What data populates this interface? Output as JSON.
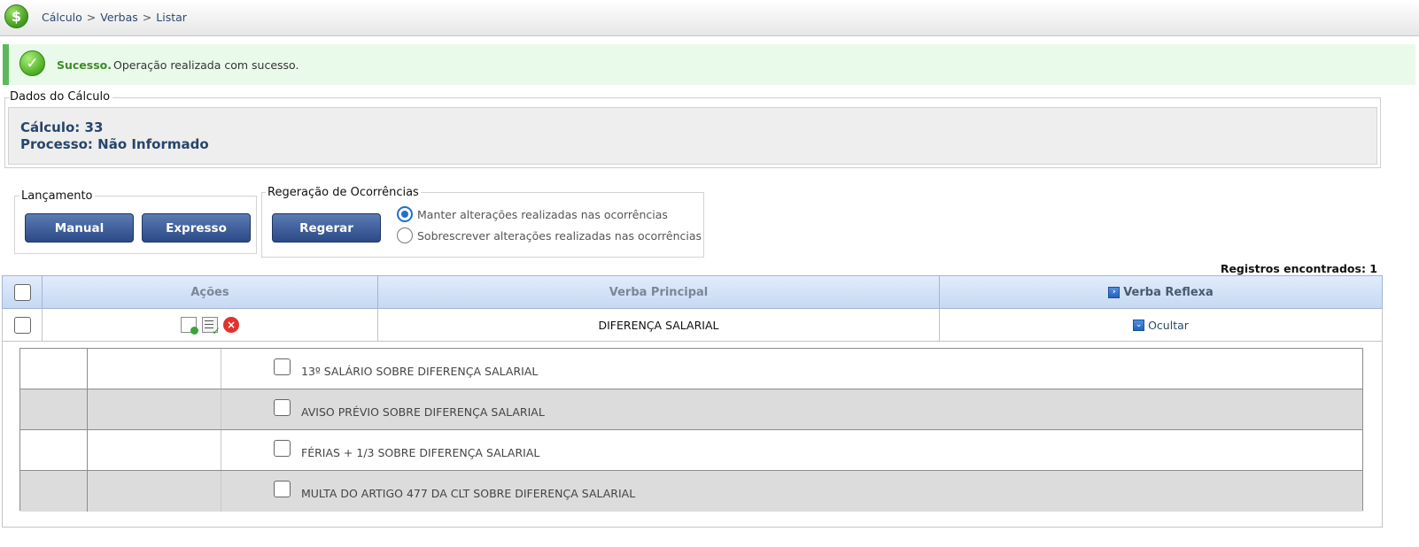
{
  "header": {
    "logo_symbol": "$",
    "breadcrumb": [
      "Cálculo",
      "Verbas",
      "Listar"
    ],
    "separator": ">"
  },
  "message": {
    "title": "Sucesso.",
    "text": "Operação realizada com sucesso.",
    "icon": "check-circle-icon"
  },
  "dados": {
    "legend": "Dados do Cálculo",
    "calculo": "Cálculo: 33",
    "processo": "Processo: Não Informado"
  },
  "lancamento": {
    "legend": "Lançamento",
    "manual_label": "Manual",
    "expresso_label": "Expresso"
  },
  "regeneracao": {
    "legend": "Regeração de Ocorrências",
    "regerar_label": "Regerar",
    "options": [
      {
        "label": "Manter alterações realizadas nas ocorrências",
        "selected": true
      },
      {
        "label": "Sobrescrever alterações realizadas nas ocorrências",
        "selected": false
      }
    ]
  },
  "records": "Registros encontrados: 1",
  "table": {
    "columns": [
      "Ações",
      "Verba Principal",
      "Verba Reflexa"
    ],
    "rows": [
      {
        "verba_principal": "DIFERENÇA SALARIAL",
        "verba_reflexa_action": "Ocultar"
      }
    ]
  },
  "reflexas": [
    "13º SALÁRIO SOBRE DIFERENÇA SALARIAL",
    "AVISO PRÉVIO SOBRE DIFERENÇA SALARIAL",
    "FÉRIAS + 1/3 SOBRE DIFERENÇA SALARIAL",
    "MULTA DO ARTIGO 477 DA CLT SOBRE DIFERENÇA SALARIAL"
  ],
  "colors": {
    "accent": "#2c4a86",
    "success": "#5cb85c",
    "header_blue": "#c6d8f3"
  }
}
